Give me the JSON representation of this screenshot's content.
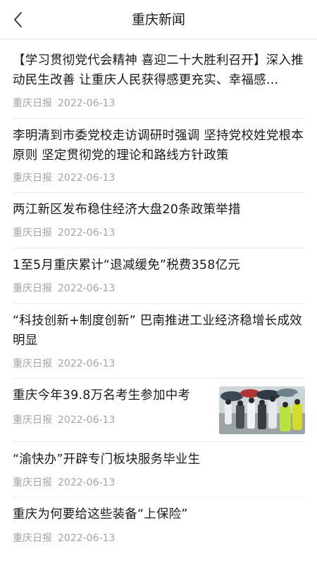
{
  "header": {
    "title": "重庆新闻",
    "back_icon": "chevron-left-icon"
  },
  "news": [
    {
      "title": "【学习贯彻党代会精神 喜迎二十大胜利召开】深入推动民生改善 让重庆人民获得感更充实、幸福感…",
      "source": "重庆日报",
      "date": "2022-06-13"
    },
    {
      "title": "李明清到市委党校走访调研时强调 坚持党校姓党根本原则 坚定贯彻党的理论和路线方针政策",
      "source": "重庆日报",
      "date": "2022-06-13"
    },
    {
      "title": "两江新区发布稳住经济大盘20条政策举措",
      "source": "重庆日报",
      "date": "2022-06-13"
    },
    {
      "title": "1至5月重庆累计“退减缓免”税费358亿元",
      "source": "重庆日报",
      "date": "2022-06-13"
    },
    {
      "title": "“科技创新+制度创新” 巴南推进工业经济稳增长成效明显",
      "source": "重庆日报",
      "date": "2022-06-13"
    },
    {
      "title": "重庆今年39.8万名考生参加中考",
      "source": "重庆日报",
      "date": "2022-06-13",
      "has_thumbnail": true
    },
    {
      "title": "“渝快办”开辟专门板块服务毕业生",
      "source": "重庆日报",
      "date": "2022-06-13"
    },
    {
      "title": "重庆为何要给这些装备“上保险”",
      "source": "重庆日报",
      "date": "2022-06-13"
    }
  ]
}
